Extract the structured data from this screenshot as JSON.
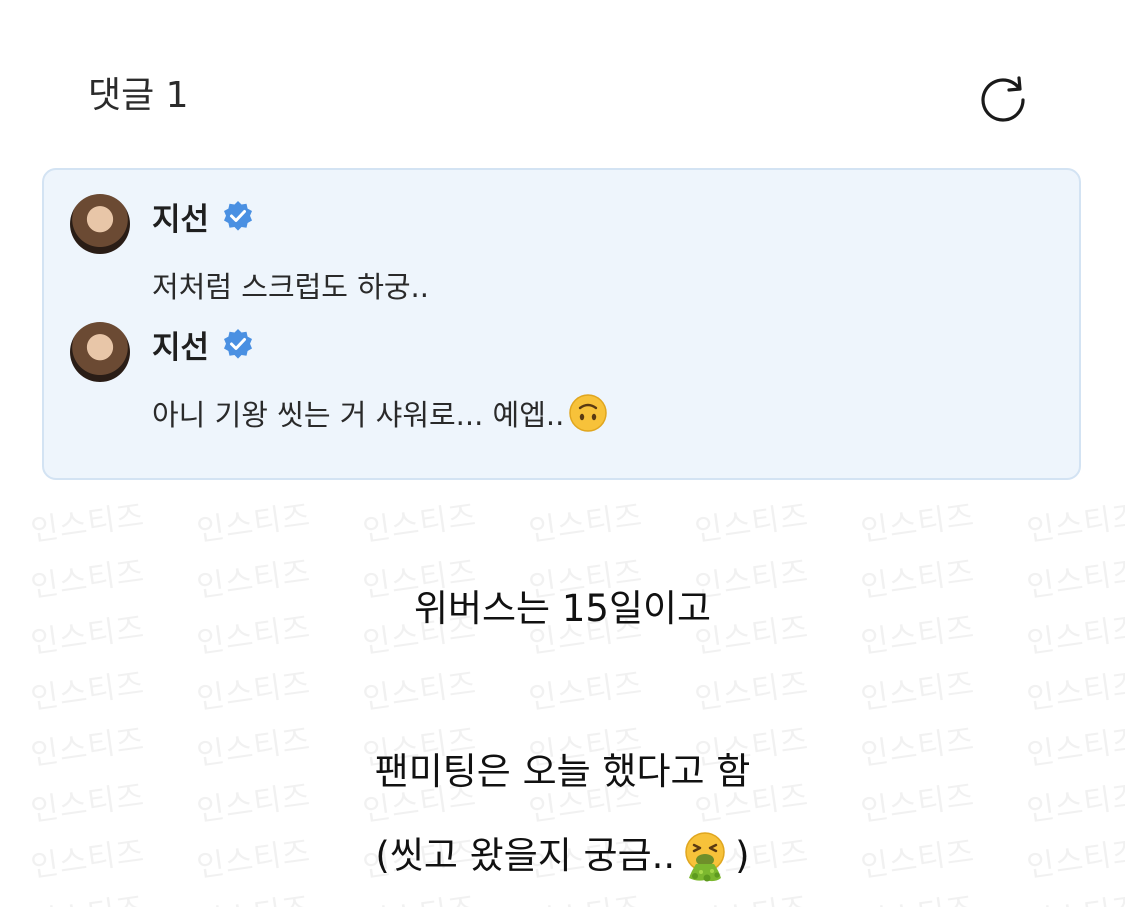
{
  "header": {
    "title": "댓글 1",
    "refresh_icon": "refresh-icon"
  },
  "comments": [
    {
      "author": "지선",
      "verified_icon": "verified-badge-icon",
      "text": "저처럼 스크럽도 하궁.."
    },
    {
      "author": "지선",
      "verified_icon": "verified-badge-icon",
      "text": "아니 기왕 씻는 거 샤워로... 예엡..",
      "emoji": "upside-down-face-emoji"
    }
  ],
  "watermark": "인스티즈",
  "captions": {
    "line1": "위버스는 15일이고",
    "line2": "팬미팅은 오늘 했다고 함",
    "line3_before": "(씻고 왔을지 궁금..",
    "line3_emoji": "vomiting-face-emoji",
    "line3_after": ")"
  },
  "colors": {
    "panel_bg": "#eef5fc",
    "panel_border": "#d3e3f3",
    "verified": "#4a90e2"
  }
}
